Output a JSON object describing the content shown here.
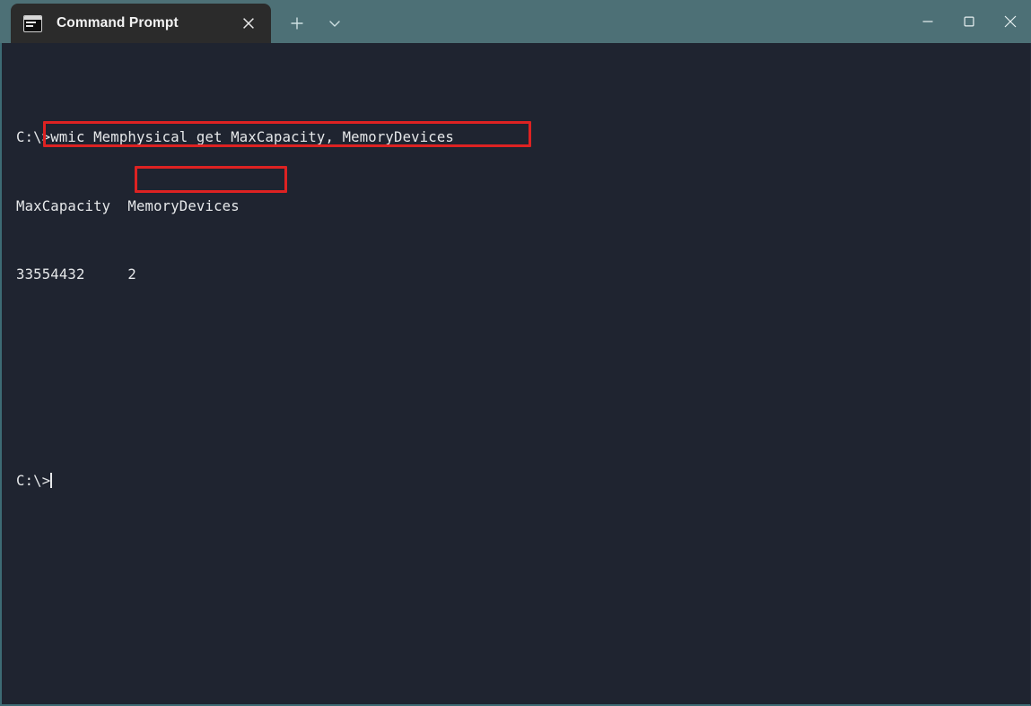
{
  "window": {
    "app_title": "Command Prompt",
    "titlebar_color": "#4d7076",
    "terminal_background": "#1f2430",
    "tab_background": "#2b2b2b"
  },
  "tab_bar": {
    "active_tab": {
      "label": "Command Prompt",
      "icon": "console-icon",
      "close_icon": "close-icon"
    },
    "new_tab_button": {
      "icon": "plus-icon",
      "tooltip": "New tab"
    },
    "tab_menu_button": {
      "icon": "chevron-down-icon",
      "tooltip": "Open dropdown"
    }
  },
  "caption_buttons": {
    "minimize": {
      "icon": "minimize-icon"
    },
    "maximize": {
      "icon": "maximize-icon"
    },
    "close": {
      "icon": "close-icon"
    }
  },
  "terminal": {
    "lines": [
      {
        "id": "command_line",
        "text": "C:\\>wmic Memphysical get MaxCapacity, MemoryDevices"
      },
      {
        "id": "header_line",
        "text": "MaxCapacity  MemoryDevices"
      },
      {
        "id": "values_line",
        "text": "33554432     2"
      },
      {
        "id": "blank_line_1",
        "text": ""
      },
      {
        "id": "blank_line_2",
        "text": ""
      },
      {
        "id": "prompt_line",
        "text": "C:\\>"
      }
    ],
    "prompt": "C:\\>",
    "command": "wmic Memphysical get MaxCapacity, MemoryDevices",
    "output": {
      "columns": [
        "MaxCapacity",
        "MemoryDevices"
      ],
      "rows": [
        [
          "33554432",
          "2"
        ]
      ]
    },
    "cursor_visible": true,
    "text_color": "#e6e8ea"
  },
  "annotations": {
    "highlight_color": "#dd2222",
    "boxes": [
      {
        "name": "command-highlight",
        "target": ">wmic Memphysical get MaxCapacity, MemoryDevices"
      },
      {
        "name": "memorydevices-value-highlight",
        "target": "2"
      }
    ]
  }
}
